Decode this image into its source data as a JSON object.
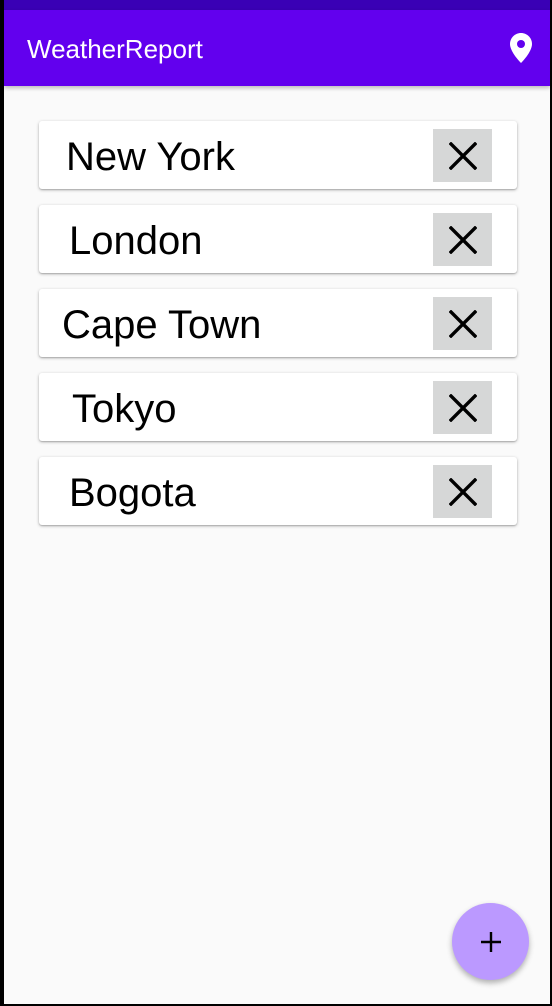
{
  "app_bar": {
    "title": "WeatherReport",
    "location_icon": "location-pin-icon",
    "background_color": "#6200ee"
  },
  "cities": [
    {
      "name": "New York",
      "remove_icon": "close-icon"
    },
    {
      "name": "London",
      "remove_icon": "close-icon"
    },
    {
      "name": "Cape Town",
      "remove_icon": "close-icon"
    },
    {
      "name": "Tokyo",
      "remove_icon": "close-icon"
    },
    {
      "name": "Bogota",
      "remove_icon": "close-icon"
    }
  ],
  "fab": {
    "icon": "plus-icon",
    "color": "#bb99ff"
  }
}
